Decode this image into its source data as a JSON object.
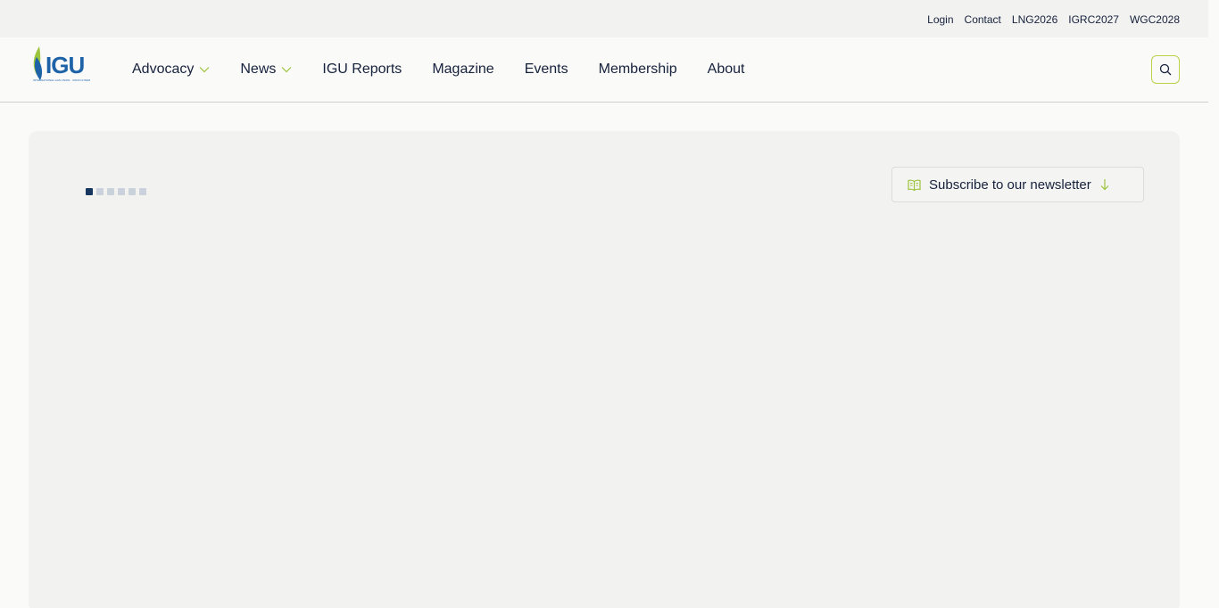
{
  "utility_nav": {
    "links": [
      "Login",
      "Contact",
      "LNG2026",
      "IGRC2027",
      "WGC2028"
    ]
  },
  "logo": {
    "wordmark": "IGU",
    "tagline": "INTERNATIONAL GAS UNION · UNION INTERNATIONALE DU GAZ",
    "icon": "flame-leaf-icon"
  },
  "main_nav": {
    "items": [
      {
        "label": "Advocacy",
        "has_dropdown": true
      },
      {
        "label": "News",
        "has_dropdown": true
      },
      {
        "label": "IGU Reports",
        "has_dropdown": false
      },
      {
        "label": "Magazine",
        "has_dropdown": false
      },
      {
        "label": "Events",
        "has_dropdown": false
      },
      {
        "label": "Membership",
        "has_dropdown": false
      },
      {
        "label": "About",
        "has_dropdown": false
      }
    ],
    "search_icon": "search-icon"
  },
  "hero": {
    "carousel": {
      "slide_count": 6,
      "active_index": 0
    },
    "subscribe_label": "Subscribe to our newsletter",
    "subscribe_icon": "open-book-icon",
    "subscribe_arrow": "arrow-down-icon"
  },
  "colors": {
    "navy": "#16213b",
    "brand_blue": "#1e63a8",
    "accent_green": "#9cc43c",
    "active_dot": "#16365f",
    "inactive_dot": "#c9d2db",
    "panel_bg": "#f2f2f1"
  }
}
